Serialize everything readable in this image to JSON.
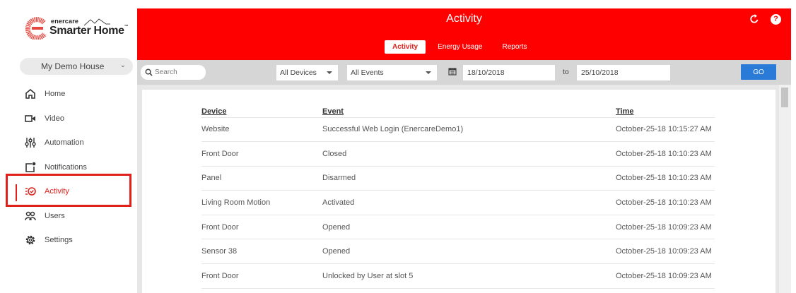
{
  "brand": {
    "small": "enercare",
    "big": "Smarter Home",
    "tm": "™",
    "accent_color": "#ff0000"
  },
  "sidebar": {
    "house": "My Demo House",
    "items": [
      {
        "label": "Home",
        "icon": "home-icon"
      },
      {
        "label": "Video",
        "icon": "video-camera-icon"
      },
      {
        "label": "Automation",
        "icon": "sliders-icon"
      },
      {
        "label": "Notifications",
        "icon": "notification-icon"
      },
      {
        "label": "Activity",
        "icon": "activity-icon",
        "active": true
      },
      {
        "label": "Users",
        "icon": "users-icon"
      },
      {
        "label": "Settings",
        "icon": "gear-icon"
      }
    ]
  },
  "header": {
    "title": "Activity",
    "tabs": [
      {
        "label": "Activity",
        "active": true
      },
      {
        "label": "Energy Usage"
      },
      {
        "label": "Reports"
      }
    ],
    "help": "?"
  },
  "filters": {
    "search_placeholder": "Search",
    "devices": "All Devices",
    "events": "All Events",
    "from_date": "18/10/2018",
    "to_label": "to",
    "to_date": "25/10/2018",
    "go_label": "GO"
  },
  "table": {
    "headers": {
      "device": "Device",
      "event": "Event",
      "time": "Time"
    },
    "rows": [
      {
        "device": "Website",
        "event": "Successful Web Login (EnercareDemo1)",
        "time": "October-25-18 10:15:27 AM"
      },
      {
        "device": "Front Door",
        "event": "Closed",
        "time": "October-25-18 10:10:23 AM"
      },
      {
        "device": "Panel",
        "event": "Disarmed",
        "time": "October-25-18 10:10:23 AM"
      },
      {
        "device": "Living Room Motion",
        "event": "Activated",
        "time": "October-25-18 10:10:23 AM"
      },
      {
        "device": "Front Door",
        "event": "Opened",
        "time": "October-25-18 10:09:23 AM"
      },
      {
        "device": "Sensor 38",
        "event": "Opened",
        "time": "October-25-18 10:09:23 AM"
      },
      {
        "device": "Front Door",
        "event": "Unlocked by User at slot 5",
        "time": "October-25-18 10:09:23 AM"
      }
    ]
  }
}
